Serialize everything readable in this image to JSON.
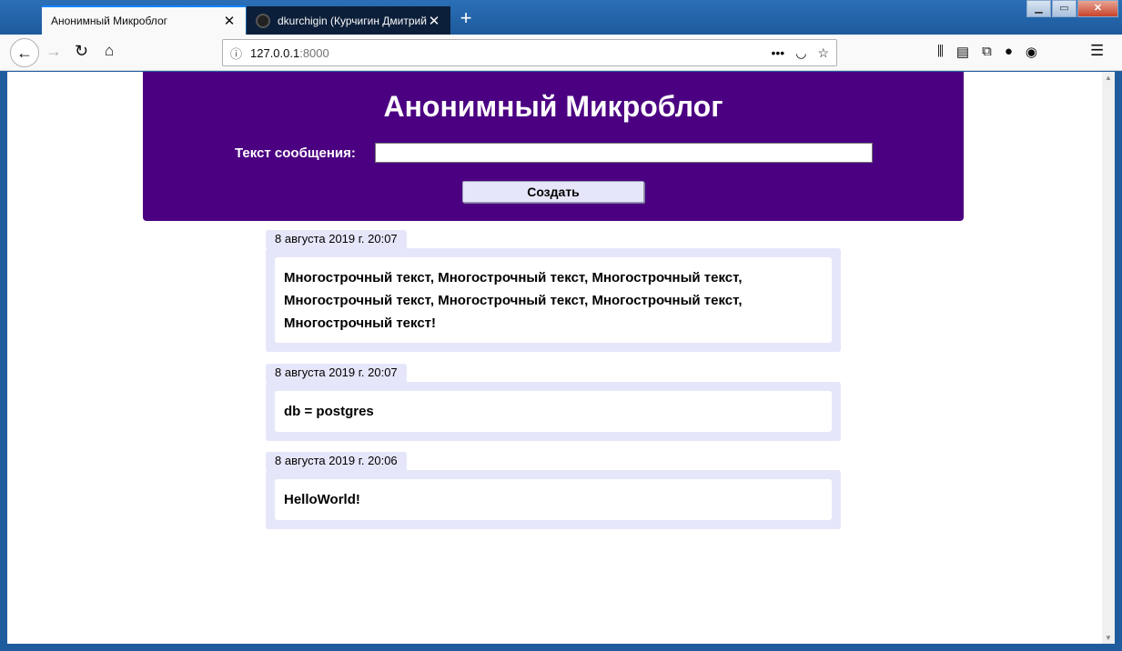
{
  "browser": {
    "tabs": [
      {
        "title": "Анонимный Микроблог",
        "active": true
      },
      {
        "title": "dkurchigin (Курчигин Дмитрий",
        "active": false
      }
    ],
    "url_host": "127.0.0.1",
    "url_port": ":8000",
    "new_tab": "+",
    "icons": {
      "back": "back-arrow-icon",
      "forward": "forward-arrow-icon",
      "reload": "reload-icon",
      "home": "home-icon",
      "page_info": "info-icon",
      "page_actions": "more-icon",
      "pocket": "pocket-icon",
      "bookmark": "star-icon",
      "library": "library-icon",
      "sidebar": "sidebar-icon",
      "sync": "sync-icon",
      "extension": "extension-icon",
      "account": "account-icon",
      "menu": "hamburger-menu-icon"
    }
  },
  "app": {
    "title": "Анонимный Микроблог",
    "form": {
      "label": "Текст сообщения:",
      "value": "",
      "submit_label": "Создать"
    },
    "accent_color": "#4b0082",
    "card_color": "#e6e6fa"
  },
  "posts": [
    {
      "date": "8 августа 2019 г. 20:07",
      "text": "Многострочный текст, Многострочный текст, Многострочный текст, Многострочный текст, Многострочный текст, Многострочный текст, Многострочный текст!"
    },
    {
      "date": "8 августа 2019 г. 20:07",
      "text": "db = postgres"
    },
    {
      "date": "8 августа 2019 г. 20:06",
      "text": "HelloWorld!"
    }
  ]
}
